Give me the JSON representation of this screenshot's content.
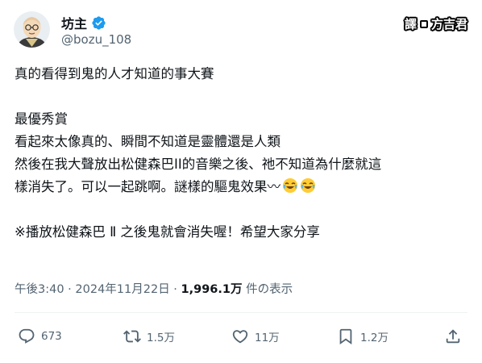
{
  "author": {
    "display_name": "坊主",
    "handle": "@bozu_108",
    "avatar_icon": "monk-avatar-icon",
    "verified_icon": "verified-badge-icon",
    "verified_color": "#1d9bf0"
  },
  "watermark": {
    "left": "譯",
    "right": "方吉君"
  },
  "post": {
    "lines": [
      "真的看得到鬼的人才知道的事大賽",
      "",
      "最優秀賞",
      "看起來太像真的、瞬間不知道是靈體還是人類",
      "然後在我大聲放出松健森巴II的音樂之後、祂不知道為什麼就這",
      "樣消失了。可以一起跳啊。謎樣的驅鬼效果〰",
      "",
      "※播放松健森巴 Ⅱ 之後鬼就會消失喔！希望大家分享"
    ],
    "emoji_icon": "face-with-tears-of-joy-icon"
  },
  "meta": {
    "time_date": "午後3:40 · 2024年11月22日 · ",
    "views_count": "1,996.1万",
    "views_suffix": " 件の表示"
  },
  "actions": {
    "reply_count": "673",
    "repost_count": "1.5万",
    "like_count": "11万",
    "bookmark_count": "1.2万"
  },
  "colors": {
    "text": "#0f1419",
    "secondary": "#536471",
    "accent": "#1d9bf0"
  }
}
